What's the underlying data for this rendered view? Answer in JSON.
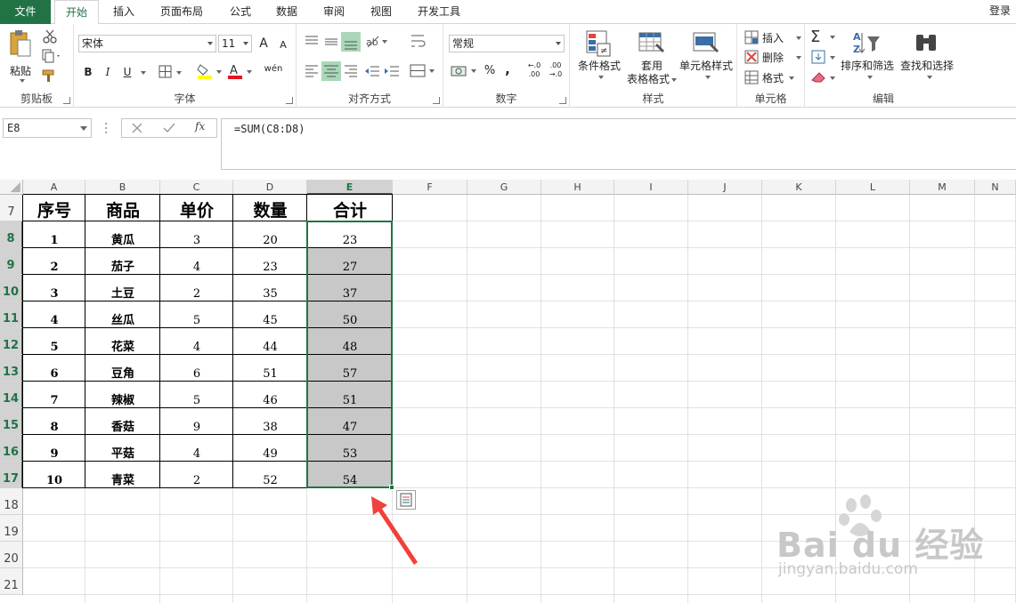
{
  "tabs": {
    "file": "文件",
    "items": [
      "开始",
      "插入",
      "页面布局",
      "公式",
      "数据",
      "审阅",
      "视图",
      "开发工具"
    ],
    "login": "登录"
  },
  "ribbon": {
    "clipboard": {
      "label": "剪贴板",
      "paste": "粘贴"
    },
    "font": {
      "label": "字体",
      "family": "宋体",
      "size": "11",
      "bold": "B",
      "italic": "I",
      "underline": "U",
      "grow": "A",
      "shrink": "A",
      "wen": "wén"
    },
    "alignment": {
      "label": "对齐方式"
    },
    "number": {
      "label": "数字",
      "format": "常规",
      "percent": "%",
      "comma": ",",
      "inc_decimal": "←.0 .00",
      "dec_decimal": ".00 →.0"
    },
    "styles": {
      "label": "样式",
      "conditional": "条件格式",
      "table_line1": "套用",
      "table_line2": "表格格式",
      "cell_styles": "单元格样式"
    },
    "cells": {
      "label": "单元格",
      "insert": "插入",
      "delete": "删除",
      "format": "格式"
    },
    "editing": {
      "label": "编辑",
      "sort": "排序和筛选",
      "find": "查找和选择"
    }
  },
  "formula_bar": {
    "name_box": "E8",
    "fx": "fx",
    "formula": "=SUM(C8:D8)"
  },
  "columns": [
    "A",
    "B",
    "C",
    "D",
    "E",
    "F",
    "G",
    "H",
    "I",
    "J",
    "K",
    "L",
    "M",
    "N"
  ],
  "rows": [
    "7",
    "8",
    "9",
    "10",
    "11",
    "12",
    "13",
    "14",
    "15",
    "16",
    "17",
    "18",
    "19",
    "20",
    "21"
  ],
  "table": {
    "headers": [
      "序号",
      "商品",
      "单价",
      "数量",
      "合计"
    ],
    "rows": [
      [
        "1",
        "黄瓜",
        "3",
        "20",
        "23"
      ],
      [
        "2",
        "茄子",
        "4",
        "23",
        "27"
      ],
      [
        "3",
        "土豆",
        "2",
        "35",
        "37"
      ],
      [
        "4",
        "丝瓜",
        "5",
        "45",
        "50"
      ],
      [
        "5",
        "花菜",
        "4",
        "44",
        "48"
      ],
      [
        "6",
        "豆角",
        "6",
        "51",
        "57"
      ],
      [
        "7",
        "辣椒",
        "5",
        "46",
        "51"
      ],
      [
        "8",
        "香菇",
        "9",
        "38",
        "47"
      ],
      [
        "9",
        "平菇",
        "4",
        "49",
        "53"
      ],
      [
        "10",
        "青菜",
        "2",
        "52",
        "54"
      ]
    ]
  },
  "selection": {
    "column": "E",
    "start_row": "8",
    "end_row": "17"
  },
  "colors": {
    "accent": "#217346",
    "arrow": "#f0413a",
    "fill": "#c8c8c8"
  },
  "watermark": {
    "brand": "Bai du 经验",
    "url": "jingyan.baidu.com"
  }
}
